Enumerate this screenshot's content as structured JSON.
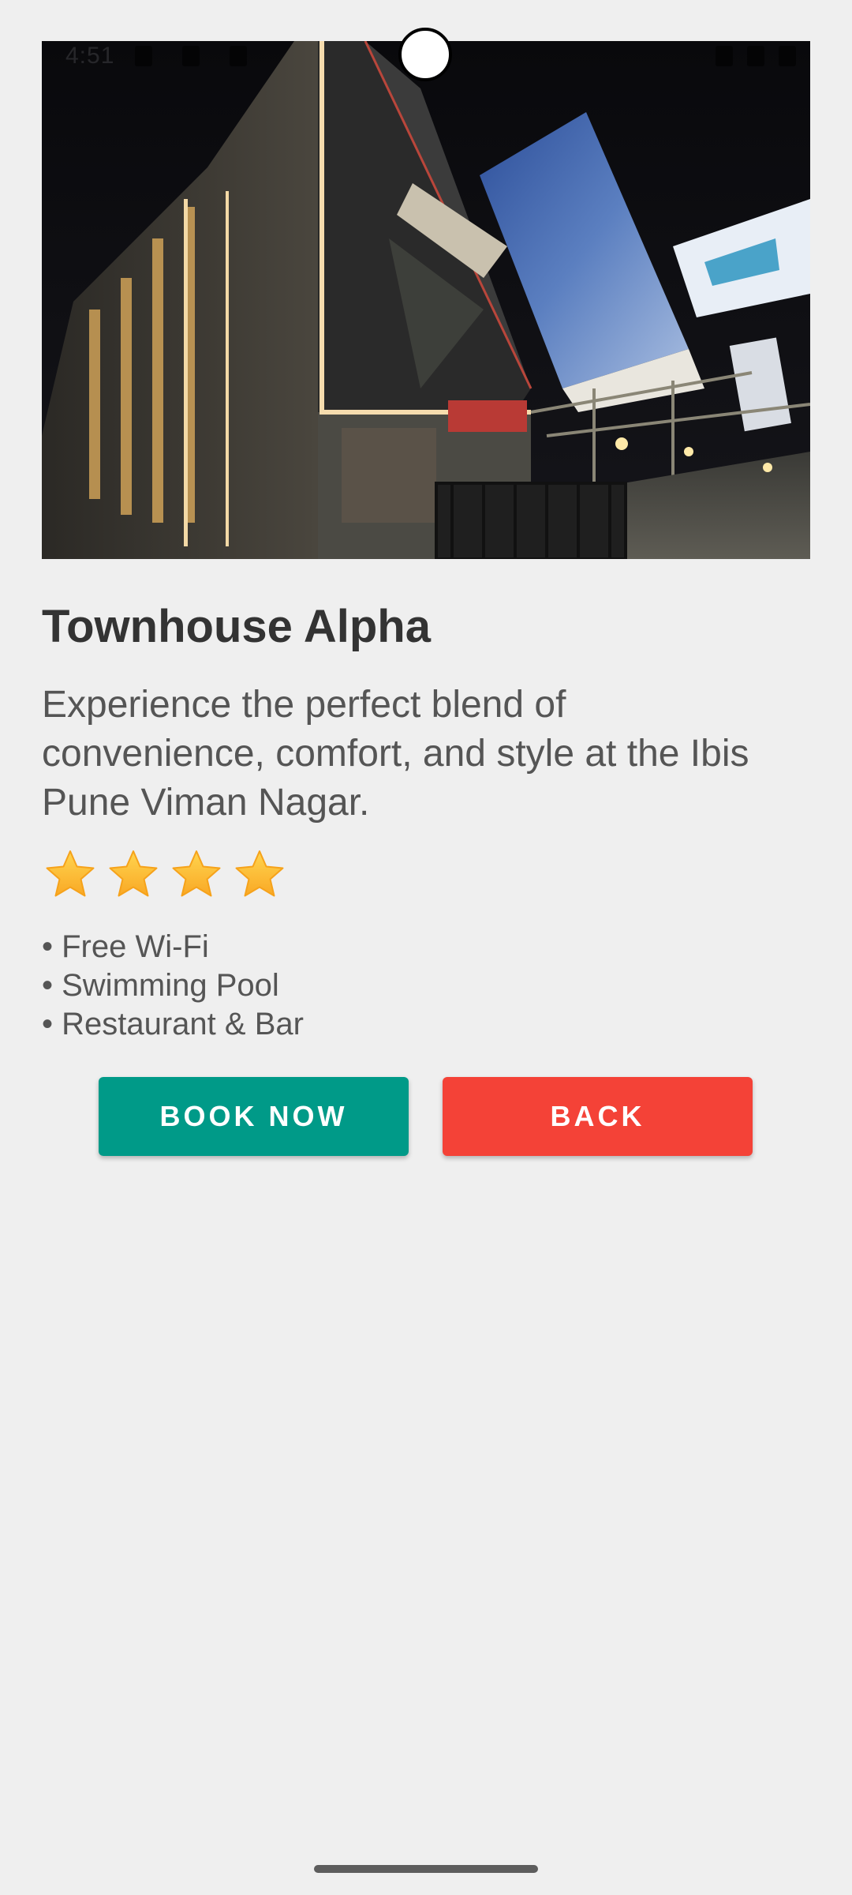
{
  "status_bar": {
    "time": "4:51",
    "icons": [
      "sim-card-icon",
      "notification-icon",
      "dnd-icon",
      "wifi-icon",
      "signal-icon",
      "battery-icon"
    ]
  },
  "hotel": {
    "image_alt": "Hotel building exterior at night",
    "name": "Townhouse Alpha",
    "description": "Experience the perfect blend of convenience, comfort, and style at the Ibis Pune Viman Nagar.",
    "rating": 4,
    "amenities": [
      "• Free Wi-Fi",
      "• Swimming Pool",
      "• Restaurant & Bar"
    ]
  },
  "actions": {
    "book_label": "BOOK NOW",
    "back_label": "BACK"
  },
  "colors": {
    "background": "#efefef",
    "book_button": "#009a88",
    "back_button": "#f44237",
    "title_text": "#333333",
    "body_text": "#555555",
    "star": "#fbc02d"
  }
}
